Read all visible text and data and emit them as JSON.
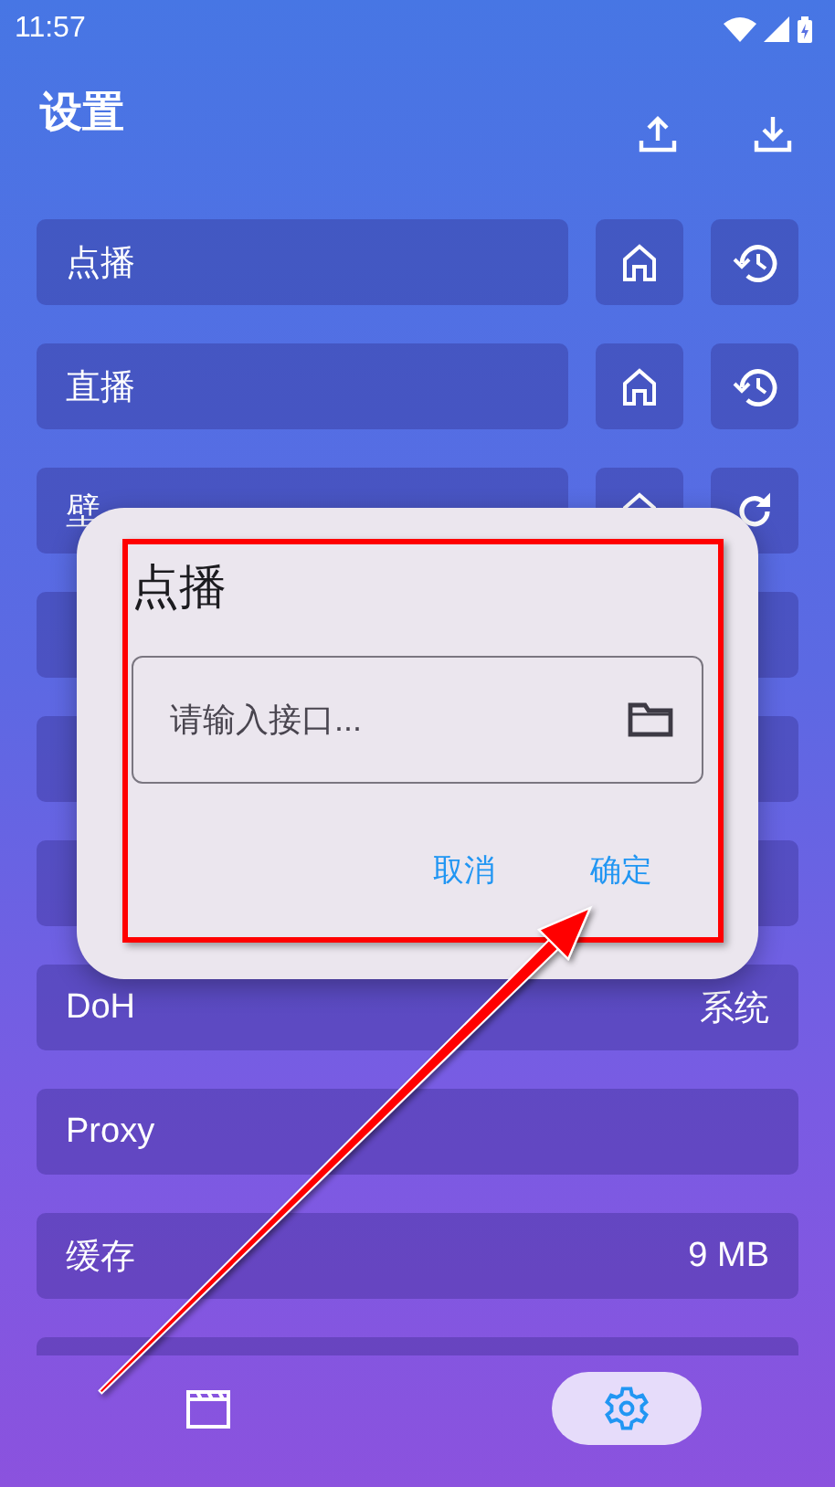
{
  "status_bar": {
    "time": "11:57"
  },
  "header": {
    "title": "设置"
  },
  "rows": [
    {
      "kind": "source",
      "label": "点播"
    },
    {
      "kind": "source",
      "label": "直播"
    },
    {
      "kind": "wallpaper",
      "label": "壁"
    },
    {
      "kind": "plain"
    },
    {
      "kind": "plain"
    },
    {
      "kind": "plain"
    },
    {
      "kind": "plain",
      "label": "DoH",
      "value": "系统"
    },
    {
      "kind": "plain",
      "label": "Proxy"
    },
    {
      "kind": "plain",
      "label": "缓存",
      "value": "9 MB"
    },
    {
      "kind": "plain"
    }
  ],
  "dialog": {
    "title": "点播",
    "placeholder": "请输入接口...",
    "buttons": [
      "取消",
      "确定"
    ]
  },
  "nav": [
    {
      "kind": "videos",
      "selected": false
    },
    {
      "kind": "settings",
      "selected": true
    }
  ]
}
